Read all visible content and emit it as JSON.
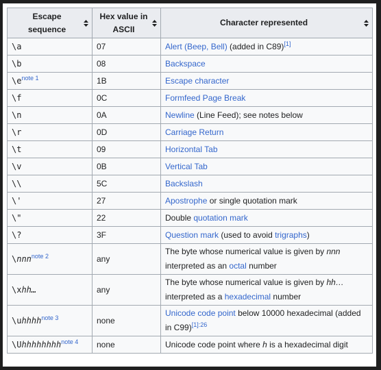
{
  "headers": {
    "escape": [
      "Escape",
      "sequence"
    ],
    "hex": [
      "Hex value in",
      "ASCII"
    ],
    "char": "Character represented"
  },
  "icons": {
    "sort": "sort-arrows-icon"
  },
  "colors": {
    "link": "#3366cc",
    "header_bg": "#eaecf0",
    "border": "#a2a9b1"
  },
  "rows": [
    {
      "esc": "\\a",
      "hex": "07",
      "c1": "Alert (Beep, Bell)",
      "c2": " (added in C89)",
      "ref": "[1]"
    },
    {
      "esc": "\\b",
      "hex": "08",
      "c1": "Backspace"
    },
    {
      "esc": "\\e",
      "note": "note 1",
      "hex": "1B",
      "c1": "Escape character"
    },
    {
      "esc": "\\f",
      "hex": "0C",
      "c1": "Formfeed Page Break"
    },
    {
      "esc": "\\n",
      "hex": "0A",
      "c1": "Newline",
      "c2": " (Line Feed); see notes below"
    },
    {
      "esc": "\\r",
      "hex": "0D",
      "c1": "Carriage Return"
    },
    {
      "esc": "\\t",
      "hex": "09",
      "c1": "Horizontal Tab"
    },
    {
      "esc": "\\v",
      "hex": "0B",
      "c1": "Vertical Tab"
    },
    {
      "esc": "\\\\",
      "hex": "5C",
      "c1": "Backslash"
    },
    {
      "esc": "\\'",
      "hex": "27",
      "c1": "Apostrophe",
      "c2": " or single quotation mark"
    },
    {
      "esc": "\\\"",
      "hex": "22",
      "c0": "Double ",
      "c1": "quotation mark"
    },
    {
      "esc": "\\?",
      "hex": "3F",
      "c1": "Question mark",
      "c2": " (used to avoid ",
      "c3": "trigraphs",
      "c4": ")"
    },
    {
      "esc": "\\",
      "esc_i": "nnn",
      "note": "note 2",
      "hex": "any",
      "line1a": "The byte whose numerical value is given by ",
      "line1i": "nnn",
      "line2a": "interpreted as an ",
      "line2l": "octal",
      "line2b": " number"
    },
    {
      "esc": "\\x",
      "esc_i": "hh…",
      "hex": "any",
      "line1a": "The byte whose numerical value is given by ",
      "line1i": "hh…",
      "line2a": "interpreted as a ",
      "line2l": "hexadecimal",
      "line2b": " number"
    },
    {
      "esc": "\\u",
      "esc_i": "hhhh",
      "note": "note 3",
      "hex": "none",
      "line1l": "Unicode code point",
      "line1a": " below 10000 hexadecimal (added",
      "line2a": "in C99)",
      "ref": "[1]:26"
    },
    {
      "esc": "\\U",
      "esc_i": "hhhhhhhh",
      "note": "note 4",
      "hex": "none",
      "line1a": "Unicode code point where ",
      "line1i": "h",
      "line1b": " is a hexadecimal digit"
    }
  ]
}
